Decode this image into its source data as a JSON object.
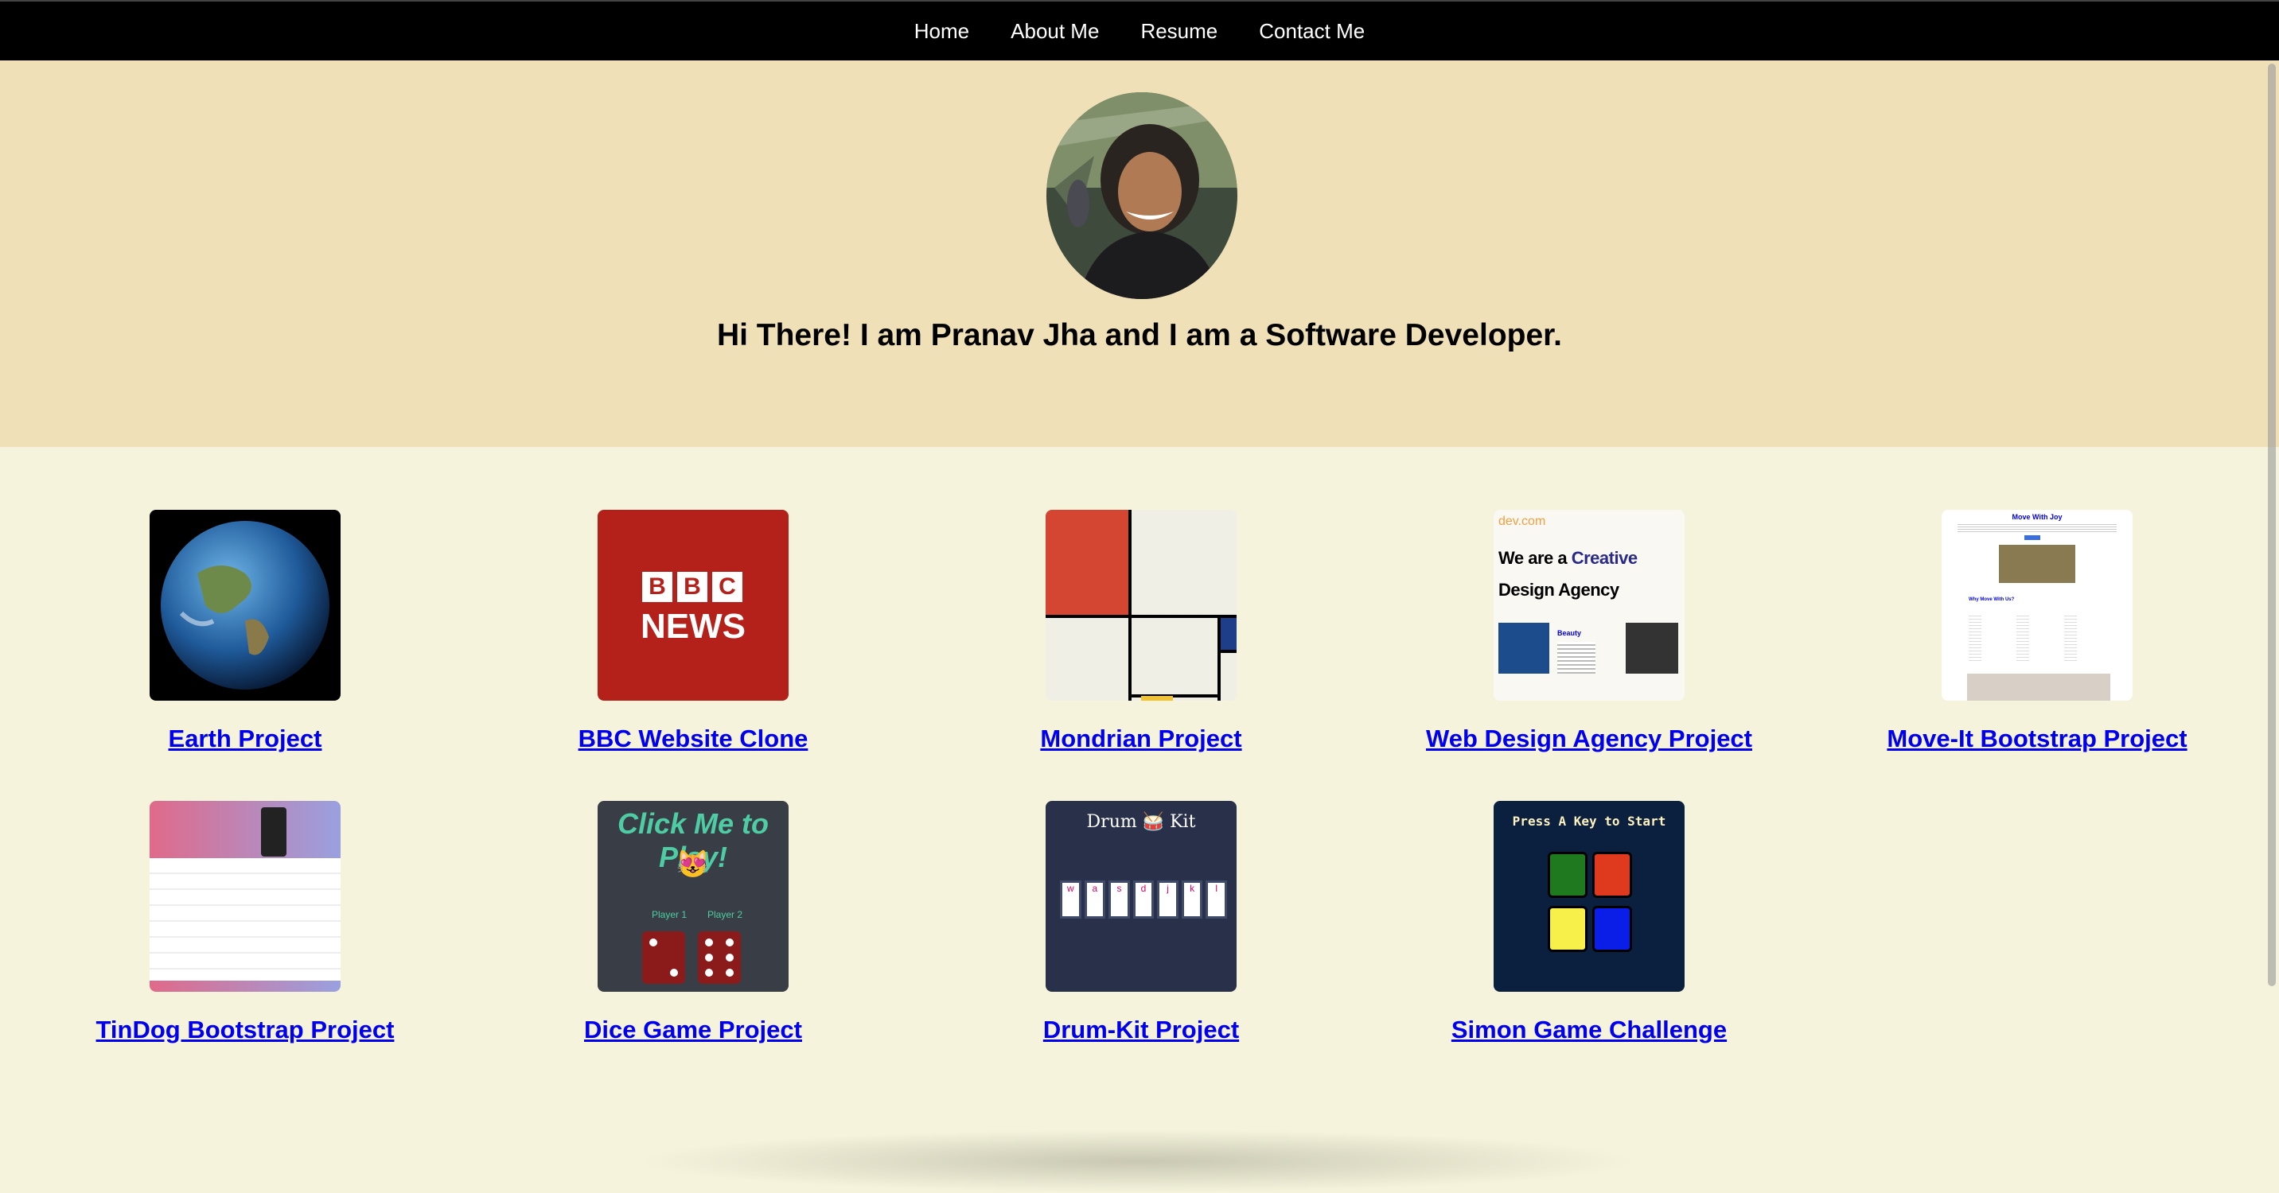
{
  "nav": {
    "items": [
      {
        "label": "Home"
      },
      {
        "label": "About Me"
      },
      {
        "label": "Resume"
      },
      {
        "label": "Contact Me"
      }
    ]
  },
  "hero": {
    "headline": "Hi There! I am Pranav Jha and I am a Software Developer."
  },
  "projects": [
    {
      "title": "Earth Project",
      "thumb": "earth"
    },
    {
      "title": "BBC Website Clone",
      "thumb": "bbc"
    },
    {
      "title": "Mondrian Project",
      "thumb": "mondrian"
    },
    {
      "title": "Web Design Agency Project",
      "thumb": "agency"
    },
    {
      "title": "Move-It Bootstrap Project",
      "thumb": "moveit"
    },
    {
      "title": "TinDog Bootstrap Project",
      "thumb": "tindog"
    },
    {
      "title": "Dice Game Project",
      "thumb": "dice"
    },
    {
      "title": "Drum-Kit Project",
      "thumb": "drumkit"
    },
    {
      "title": "Simon Game Challenge",
      "thumb": "simon"
    }
  ],
  "thumb_text": {
    "bbc_letters": [
      "B",
      "B",
      "C"
    ],
    "bbc_news": "NEWS",
    "agency_domain": "dev.com",
    "agency_line1_a": "We are a ",
    "agency_line1_b": "Creative",
    "agency_line2": "Design Agency",
    "agency_beauty": "Beauty",
    "moveit_title": "Move With Joy",
    "moveit_why": "Why Move With Us?",
    "dice_title": "Click Me to Play!",
    "dice_emoji": "😻",
    "dice_p1": "Player 1",
    "dice_p2": "Player 2",
    "drum_title": "Drum 🥁 Kit",
    "drum_keys": [
      "w",
      "a",
      "s",
      "d",
      "j",
      "k",
      "l"
    ],
    "simon_title": "Press A Key to Start"
  },
  "colors": {
    "nav_bg": "#000000",
    "hero_bg": "#f0e0b8",
    "page_bg": "#f5f3dc",
    "link": "#0000ee",
    "bbc_red": "#b3211a",
    "simon_bg": "#0b1f3f",
    "simon_green": "#1f7a1f",
    "simon_red": "#e03a1e",
    "simon_yellow": "#f7f04a",
    "simon_blue": "#0a1ee8"
  },
  "icons": {
    "avatar": "profile-photo"
  }
}
